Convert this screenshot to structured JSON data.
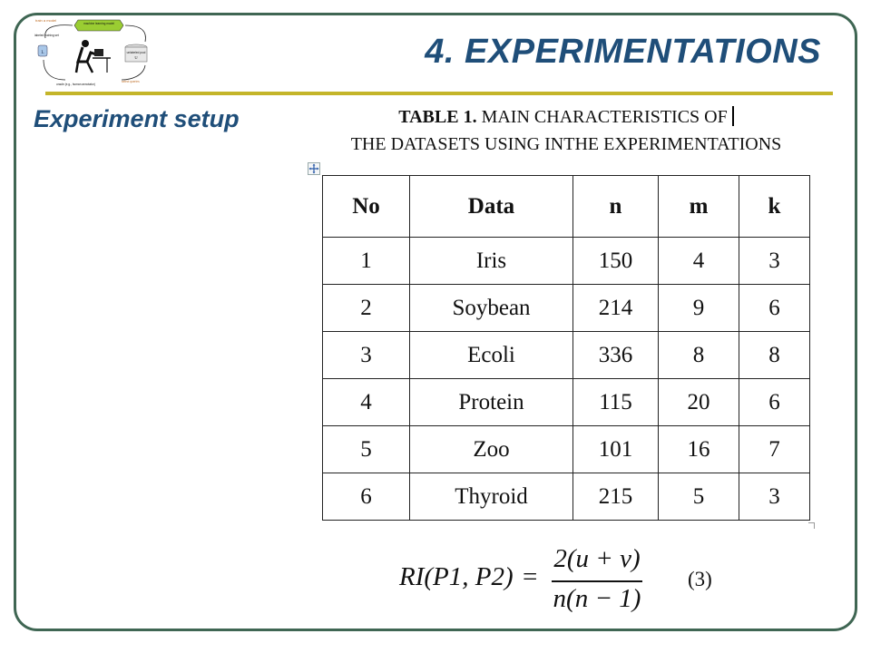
{
  "header": {
    "title": "4. EXPERIMENTATIONS",
    "subtitle": "Experiment setup"
  },
  "logo": {
    "train_label": "train a model",
    "model_label": "machine learning model",
    "labeled_label": "labeled training set",
    "labeled_symbol": "L",
    "unlabeled_label": "unlabeled pool",
    "unlabeled_symbol": "U",
    "oracle_label": "oracle (e.g., human annotator)",
    "query_label": "select queries"
  },
  "table": {
    "caption_bold": "TABLE 1.",
    "caption_line1": " MAIN CHARACTERISTICS OF",
    "caption_line2": "THE DATASETS USING INTHE EXPERIMENTATIONS",
    "headers": [
      "No",
      "Data",
      "n",
      "m",
      "k"
    ],
    "rows": [
      [
        "1",
        "Iris",
        "150",
        "4",
        "3"
      ],
      [
        "2",
        "Soybean",
        "214",
        "9",
        "6"
      ],
      [
        "3",
        "Ecoli",
        "336",
        "8",
        "8"
      ],
      [
        "4",
        "Protein",
        "115",
        "20",
        "6"
      ],
      [
        "5",
        "Zoo",
        "101",
        "16",
        "7"
      ],
      [
        "6",
        "Thyroid",
        "215",
        "5",
        "3"
      ]
    ]
  },
  "formula": {
    "lhs": "RI(P1, P2)",
    "equals": "=",
    "numerator": "2(u + v)",
    "denominator": "n(n − 1)",
    "number": "(3)"
  },
  "colors": {
    "frame": "#3f6653",
    "title": "#1f4e79",
    "rule": "#c4b52a"
  }
}
